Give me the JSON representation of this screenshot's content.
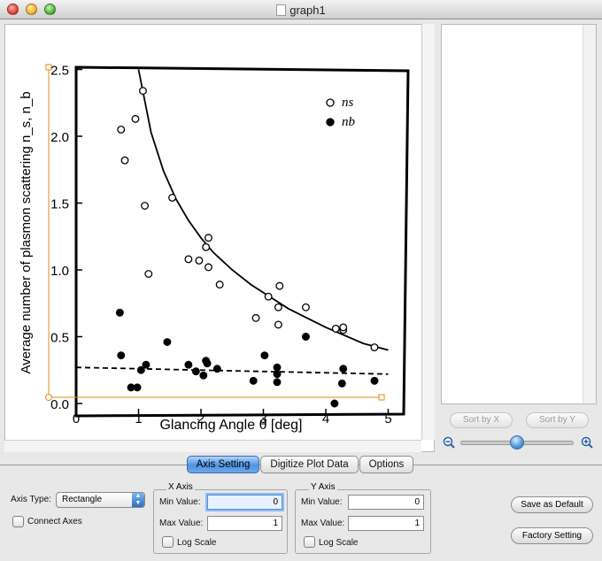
{
  "window": {
    "title": "graph1"
  },
  "plot": {
    "chart_data": {
      "type": "scatter",
      "xlabel": "Glancing Angle θ [deg]",
      "ylabel": "Average number of plasmon scattering n_s, n_b",
      "xlim": [
        -0.3,
        5.1
      ],
      "ylim": [
        -0.05,
        2.55
      ],
      "x_ticks": [
        "0",
        "1",
        "2",
        "3",
        "4",
        "5"
      ],
      "y_ticks": [
        "0.0",
        "0.5",
        "1.0",
        "1.5",
        "2.0",
        "2.5"
      ],
      "legend_position": "top-right",
      "legend": [
        {
          "symbol": "open-circle",
          "label": "ns"
        },
        {
          "symbol": "filled-circle",
          "label": "nb"
        }
      ],
      "series": [
        {
          "name": "ns",
          "marker": "open-circle",
          "points": [
            [
              1.07,
              2.34
            ],
            [
              0.95,
              2.13
            ],
            [
              0.72,
              2.05
            ],
            [
              0.78,
              1.82
            ],
            [
              1.1,
              1.48
            ],
            [
              1.54,
              1.54
            ],
            [
              1.16,
              0.97
            ],
            [
              1.8,
              1.08
            ],
            [
              1.97,
              1.07
            ],
            [
              2.08,
              1.17
            ],
            [
              2.12,
              1.24
            ],
            [
              2.12,
              1.02
            ],
            [
              2.3,
              0.89
            ],
            [
              2.88,
              0.64
            ],
            [
              3.08,
              0.8
            ],
            [
              3.26,
              0.88
            ],
            [
              3.24,
              0.72
            ],
            [
              3.24,
              0.59
            ],
            [
              3.68,
              0.72
            ],
            [
              4.16,
              0.56
            ],
            [
              4.28,
              0.55
            ],
            [
              4.28,
              0.57
            ],
            [
              4.78,
              0.42
            ]
          ]
        },
        {
          "name": "nb",
          "marker": "filled-circle",
          "points": [
            [
              0.7,
              0.68
            ],
            [
              0.72,
              0.36
            ],
            [
              0.88,
              0.12
            ],
            [
              0.98,
              0.12
            ],
            [
              1.04,
              0.25
            ],
            [
              1.12,
              0.29
            ],
            [
              1.46,
              0.46
            ],
            [
              1.8,
              0.29
            ],
            [
              1.92,
              0.24
            ],
            [
              2.04,
              0.21
            ],
            [
              2.08,
              0.32
            ],
            [
              2.1,
              0.3
            ],
            [
              2.26,
              0.26
            ],
            [
              2.84,
              0.17
            ],
            [
              3.02,
              0.36
            ],
            [
              3.22,
              0.27
            ],
            [
              3.22,
              0.22
            ],
            [
              3.22,
              0.16
            ],
            [
              3.68,
              0.5
            ],
            [
              4.14,
              0.0
            ],
            [
              4.26,
              0.15
            ],
            [
              4.28,
              0.26
            ],
            [
              4.78,
              0.17
            ]
          ]
        },
        {
          "name": "ns",
          "style": "solid-curve",
          "points": [
            [
              1.0,
              2.5
            ],
            [
              1.2,
              2.03
            ],
            [
              1.4,
              1.74
            ],
            [
              1.6,
              1.53
            ],
            [
              1.8,
              1.37
            ],
            [
              2.0,
              1.24
            ],
            [
              2.2,
              1.13
            ],
            [
              2.5,
              1.0
            ],
            [
              2.8,
              0.89
            ],
            [
              3.1,
              0.8
            ],
            [
              3.4,
              0.71
            ],
            [
              3.7,
              0.64
            ],
            [
              4.0,
              0.57
            ],
            [
              4.3,
              0.51
            ],
            [
              4.6,
              0.45
            ],
            [
              5.0,
              0.4
            ]
          ]
        },
        {
          "name": "nb",
          "style": "dashed-curve",
          "points": [
            [
              0.0,
              0.27
            ],
            [
              1.0,
              0.26
            ],
            [
              2.0,
              0.25
            ],
            [
              3.0,
              0.24
            ],
            [
              4.0,
              0.23
            ],
            [
              5.0,
              0.22
            ]
          ]
        }
      ]
    }
  },
  "sidebar": {
    "sort_x_label": "Sort by X",
    "sort_y_label": "Sort by Y"
  },
  "tabs": [
    {
      "label": "Axis Setting",
      "active": true
    },
    {
      "label": "Digitize Plot Data",
      "active": false
    },
    {
      "label": "Options",
      "active": false
    }
  ],
  "axis_setting": {
    "axis_type_label": "Axis Type:",
    "axis_type_value": "Rectangle",
    "connect_axes_label": "Connect Axes",
    "x_axis": {
      "title": "X Axis",
      "min_label": "Min Value:",
      "min_value": "0",
      "max_label": "Max Value:",
      "max_value": "1",
      "log_label": "Log Scale"
    },
    "y_axis": {
      "title": "Y Axis",
      "min_label": "Min Value:",
      "min_value": "0",
      "max_label": "Max Value:",
      "max_value": "1",
      "log_label": "Log Scale"
    },
    "save_default_label": "Save as Default",
    "factory_setting_label": "Factory Setting"
  },
  "colors": {
    "tab_active": "#4f93e0",
    "zoom_thumb": "#5a9bde",
    "axis_marker": "#e08a1a"
  }
}
